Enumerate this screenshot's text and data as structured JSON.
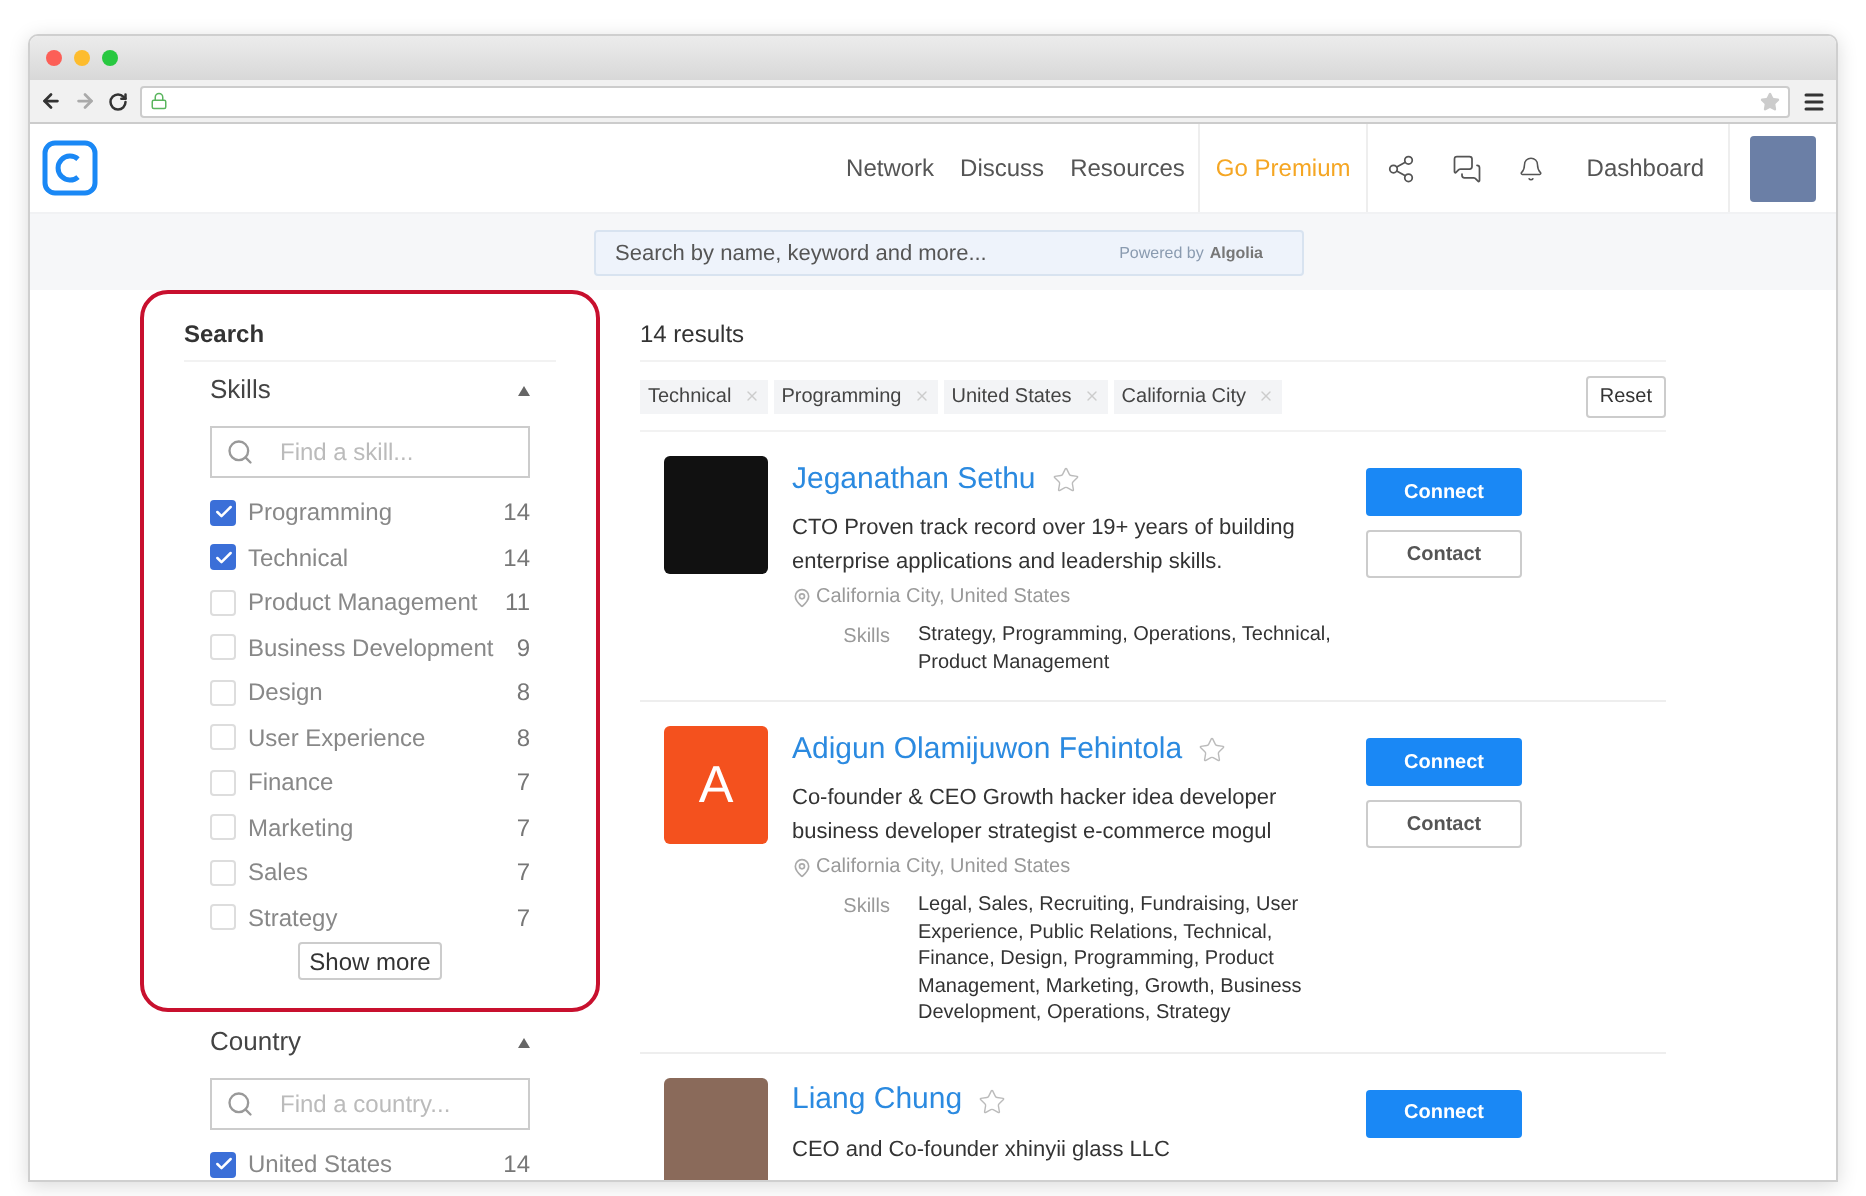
{
  "nav": {
    "links": [
      {
        "label": "Network",
        "kind": "plain"
      },
      {
        "label": "Discuss",
        "kind": "plain"
      },
      {
        "label": "Resources",
        "kind": "plain"
      },
      {
        "label": "Go Premium",
        "kind": "premium"
      }
    ],
    "dashboard": "Dashboard"
  },
  "search": {
    "placeholder": "Search by name, keyword and more...",
    "powered_by": "Powered by",
    "brand": "Algolia"
  },
  "sidebar": {
    "title": "Search",
    "skills": {
      "title": "Skills",
      "expanded": true,
      "placeholder": "Find a skill...",
      "items": [
        {
          "label": "Programming",
          "count": "14",
          "checked": true
        },
        {
          "label": "Technical",
          "count": "14",
          "checked": true
        },
        {
          "label": "Product Management",
          "count": "11",
          "checked": false
        },
        {
          "label": "Business Development",
          "count": "9",
          "checked": false
        },
        {
          "label": "Design",
          "count": "8",
          "checked": false
        },
        {
          "label": "User Experience",
          "count": "8",
          "checked": false
        },
        {
          "label": "Finance",
          "count": "7",
          "checked": false
        },
        {
          "label": "Marketing",
          "count": "7",
          "checked": false
        },
        {
          "label": "Sales",
          "count": "7",
          "checked": false
        },
        {
          "label": "Strategy",
          "count": "7",
          "checked": false
        }
      ],
      "show_more": "Show more"
    },
    "country": {
      "title": "Country",
      "expanded": true,
      "placeholder": "Find a country...",
      "items": [
        {
          "label": "United States",
          "count": "14",
          "checked": true
        }
      ]
    }
  },
  "results": {
    "count": "14 results",
    "filters": [
      "Technical",
      "Programming",
      "United States",
      "California City"
    ],
    "reset": "Reset",
    "people": [
      {
        "name": "Jeganathan Sethu",
        "avatar": {
          "kind": "photo"
        },
        "description": "CTO Proven track record over 19+ years of building enterprise applications and leadership skills.",
        "location": "California City, United States",
        "skills_label": "Skills",
        "skills": "Strategy, Programming, Operations, Technical, Product Management",
        "starred": false,
        "connect": "Connect",
        "contact": "Contact"
      },
      {
        "name": "Adigun Olamijuwon Fehintola",
        "avatar": {
          "kind": "letter",
          "letter": "A"
        },
        "description": "Co-founder & CEO Growth hacker idea developer business developer strategist e-commerce mogul",
        "location": "California City, United States",
        "skills_label": "Skills",
        "skills": "Legal, Sales, Recruiting, Fundraising, User Experience, Public Relations, Technical, Finance, Design, Programming, Product Management, Marketing, Growth, Business Development, Operations, Strategy",
        "starred": false,
        "connect": "Connect",
        "contact": "Contact"
      },
      {
        "name": "Liang Chung",
        "avatar": {
          "kind": "photo"
        },
        "description": "CEO and Co-founder xhinyii glass LLC",
        "starred": false,
        "connect": "Connect"
      }
    ]
  }
}
